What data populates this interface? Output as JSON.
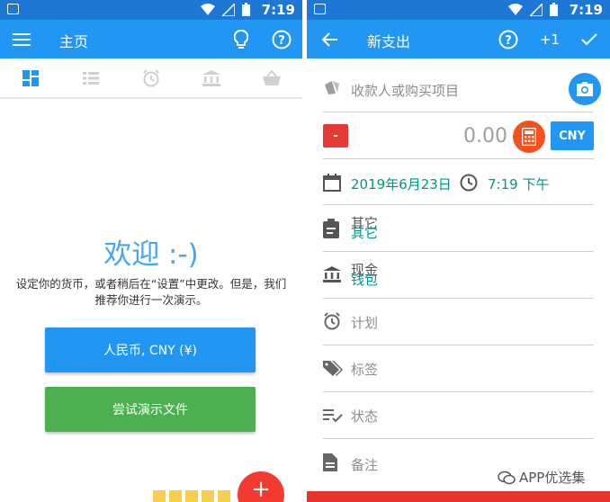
{
  "status": {
    "time": "7:19"
  },
  "home": {
    "title": "主页",
    "welcome": "欢迎 :-)",
    "description": "设定你的货币，或者稍后在“设置”中更改。但是，我们推荐你进行一次演示。",
    "currency_button": "人民币, CNY (¥)",
    "demo_button": "尝试演示文件",
    "fab_label": "+"
  },
  "expense": {
    "title": "新支出",
    "plus_one": "+1",
    "payee_placeholder": "收款人或购买项目",
    "sign": "-",
    "amount": "0.00",
    "currency": "CNY",
    "date": "2019年6月23日",
    "time": "7:19 下午",
    "category_label": "其它",
    "category_value": "其它",
    "account_label": "现金",
    "account_value": "钱包",
    "plan": "计划",
    "tags": "标签",
    "status": "状态",
    "note": "备注"
  },
  "watermark": "APP优选集",
  "colors": {
    "primary": "#2196f3",
    "primary_dark": "#1c78d4",
    "teal": "#009688",
    "green": "#4caf50",
    "fab_red": "#f23a31"
  }
}
